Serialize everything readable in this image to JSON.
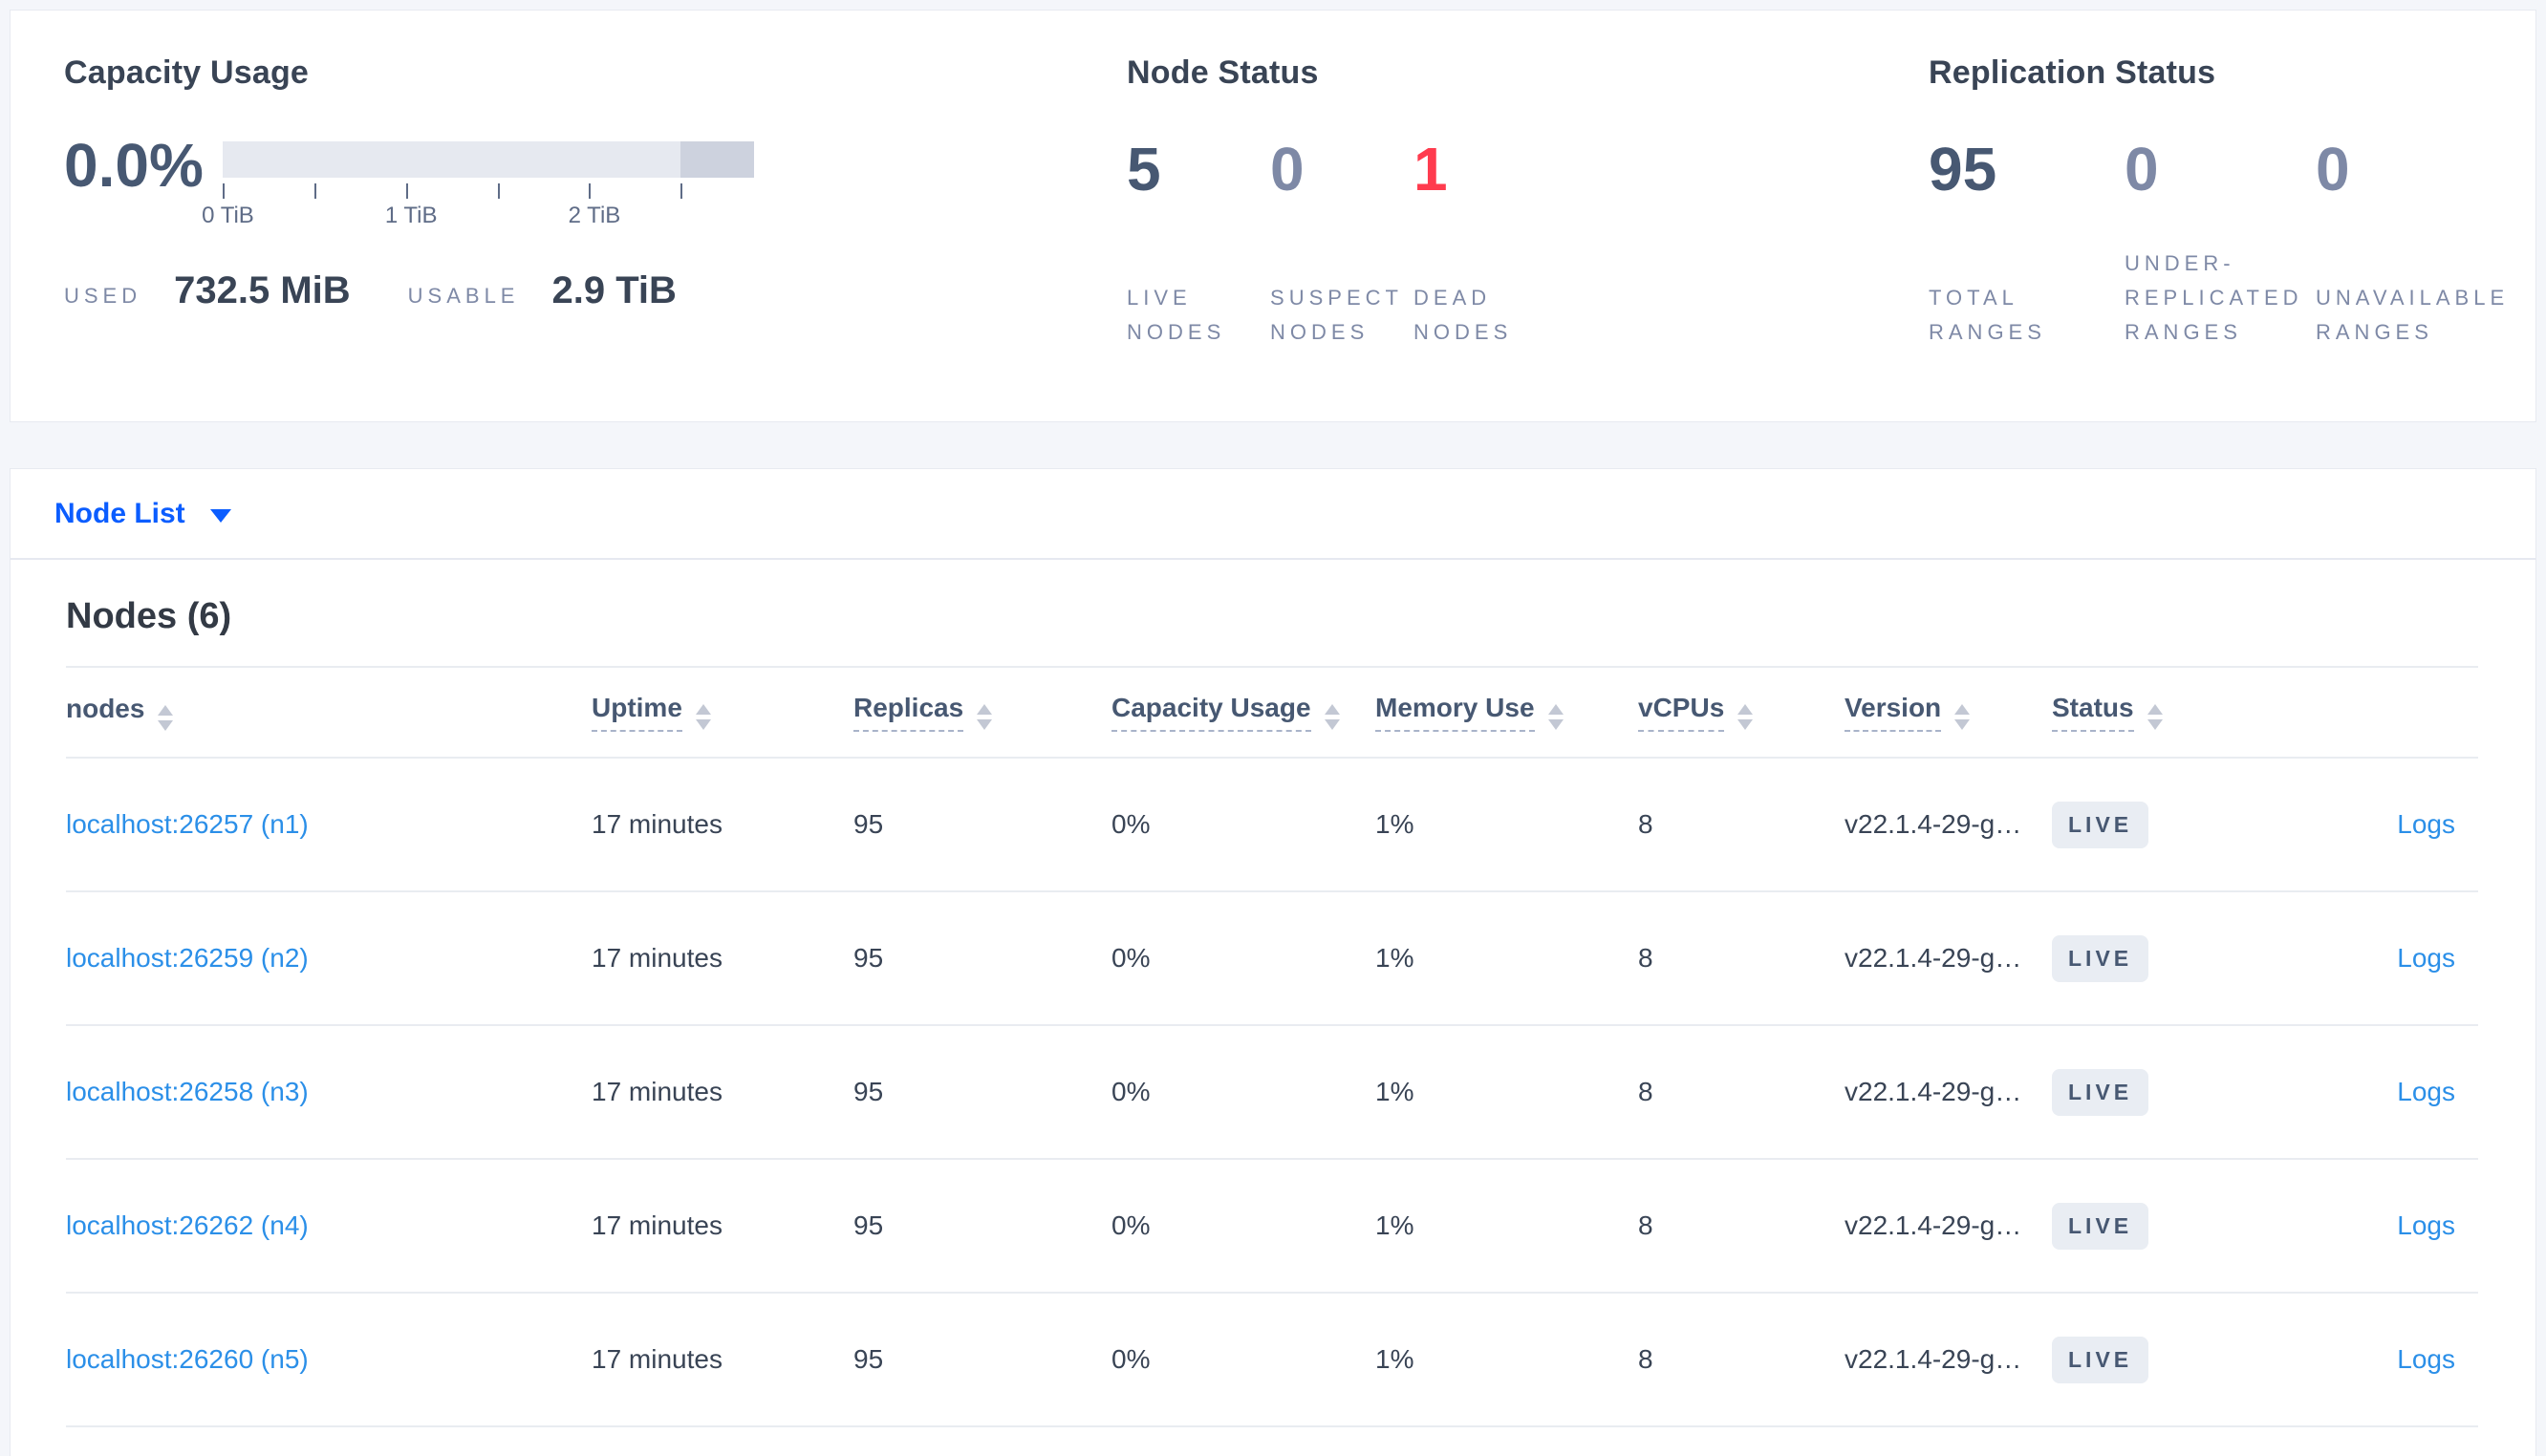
{
  "colors": {
    "accent_blue": "#0b5dff",
    "link_blue": "#2b8fe8",
    "danger_red": "#ff3b4e",
    "dark_slate": "#475872",
    "muted_slate": "#7e89a6",
    "badge_bg": "#e9edf3"
  },
  "summary": {
    "capacity": {
      "title": "Capacity Usage",
      "percent": "0.0%",
      "tick_labels": [
        "0 TiB",
        "1 TiB",
        "2 TiB"
      ],
      "used_label": "USED",
      "used_value": "732.5 MiB",
      "usable_label": "USABLE",
      "usable_value": "2.9 TiB"
    },
    "node_status": {
      "title": "Node Status",
      "stats": [
        {
          "value": "5",
          "label": [
            "LIVE",
            "NODES"
          ]
        },
        {
          "value": "0",
          "label": [
            "SUSPECT",
            "NODES"
          ]
        },
        {
          "value": "1",
          "label": [
            "DEAD",
            "NODES"
          ]
        }
      ]
    },
    "replication": {
      "title": "Replication Status",
      "stats": [
        {
          "value": "95",
          "label": [
            "TOTAL",
            "RANGES"
          ]
        },
        {
          "value": "0",
          "label": [
            "UNDER-",
            "REPLICATED",
            "RANGES"
          ]
        },
        {
          "value": "0",
          "label": [
            "UNAVAILABLE",
            "RANGES"
          ]
        }
      ]
    }
  },
  "view_selector": {
    "label": "Node List"
  },
  "table": {
    "title": "Nodes (6)",
    "columns": [
      "nodes",
      "Uptime",
      "Replicas",
      "Capacity Usage",
      "Memory Use",
      "vCPUs",
      "Version",
      "Status",
      ""
    ],
    "rows": [
      {
        "name": "localhost:26257 (n1)",
        "uptime": "17 minutes",
        "replicas": "95",
        "capacity_usage": "0%",
        "memory_use": "1%",
        "vcpus": "8",
        "version": "v22.1.4-29-g…",
        "status": "LIVE",
        "logs": "Logs"
      },
      {
        "name": "localhost:26259 (n2)",
        "uptime": "17 minutes",
        "replicas": "95",
        "capacity_usage": "0%",
        "memory_use": "1%",
        "vcpus": "8",
        "version": "v22.1.4-29-g…",
        "status": "LIVE",
        "logs": "Logs"
      },
      {
        "name": "localhost:26258 (n3)",
        "uptime": "17 minutes",
        "replicas": "95",
        "capacity_usage": "0%",
        "memory_use": "1%",
        "vcpus": "8",
        "version": "v22.1.4-29-g…",
        "status": "LIVE",
        "logs": "Logs"
      },
      {
        "name": "localhost:26262 (n4)",
        "uptime": "17 minutes",
        "replicas": "95",
        "capacity_usage": "0%",
        "memory_use": "1%",
        "vcpus": "8",
        "version": "v22.1.4-29-g…",
        "status": "LIVE",
        "logs": "Logs"
      },
      {
        "name": "localhost:26260 (n5)",
        "uptime": "17 minutes",
        "replicas": "95",
        "capacity_usage": "0%",
        "memory_use": "1%",
        "vcpus": "8",
        "version": "v22.1.4-29-g…",
        "status": "LIVE",
        "logs": "Logs"
      }
    ]
  }
}
